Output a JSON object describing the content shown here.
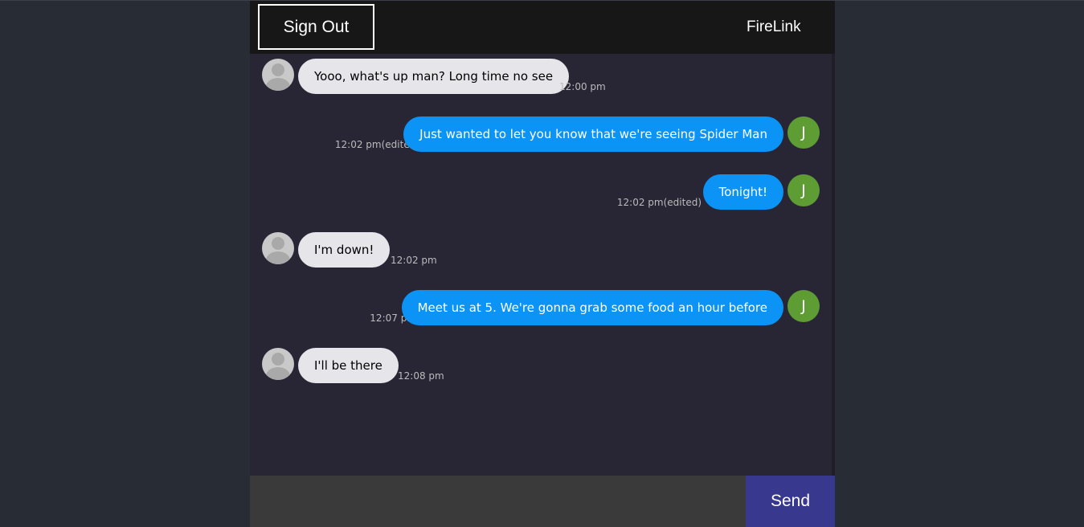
{
  "header": {
    "sign_out_label": "Sign Out",
    "brand": "FireLink"
  },
  "messages": [
    {
      "side": "received",
      "text": "Yooo, what's up man? Long time no see",
      "time": "12:00 pm",
      "avatar": "user-placeholder-icon"
    },
    {
      "side": "sent",
      "text": "Just wanted to let you know that we're seeing Spider Man",
      "time": "12:02 pm(edited)",
      "avatar_letter": "J"
    },
    {
      "side": "sent",
      "text": "Tonight!",
      "time": "12:02 pm(edited)",
      "avatar_letter": "J"
    },
    {
      "side": "received",
      "text": "I'm down!",
      "time": "12:02 pm",
      "avatar": "user-placeholder-icon"
    },
    {
      "side": "sent",
      "text": "Meet us at 5. We're gonna grab some food an hour before",
      "time": "12:07 pm",
      "avatar_letter": "J"
    },
    {
      "side": "received",
      "text": "I'll be there",
      "time": "12:08 pm",
      "avatar": "user-placeholder-icon"
    }
  ],
  "composer": {
    "value": "",
    "placeholder": ""
  },
  "send_label": "Send",
  "colors": {
    "page_bg": "#282c34",
    "chat_bg": "#282635",
    "header_bg": "#181717",
    "sent_bubble": "#0b93f6",
    "received_bubble": "#e5e5ea",
    "avatar_letter_bg": "#5e9d34",
    "send_button": "#38388f",
    "composer_bg": "#3a3a3a"
  }
}
